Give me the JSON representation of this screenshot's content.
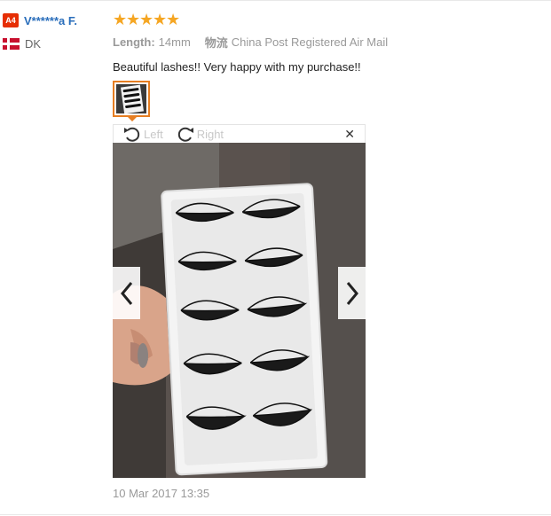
{
  "buyer": {
    "level_badge": "A4",
    "name": "V******a F.",
    "country": "DK"
  },
  "review": {
    "rating": 5,
    "attributes": {
      "length_label": "Length:",
      "length_value": "14mm",
      "shipping_label": "物流",
      "shipping_value": "China Post Registered Air Mail"
    },
    "text": "Beautiful lashes!! Very happy with my purchase!!",
    "date": "10 Mar 2017 13:35"
  },
  "viewer": {
    "rotate_left_label": "Left",
    "rotate_right_label": "Right",
    "close_glyph": "✕"
  },
  "icons": {
    "star": "star-icon",
    "rotate_left": "rotate-left-icon",
    "rotate_right": "rotate-right-icon",
    "close": "close-icon",
    "prev": "chevron-left-icon",
    "next": "chevron-right-icon"
  },
  "colors": {
    "star": "#f5a623",
    "username": "#2a6ebb",
    "badge": "#e62e04",
    "thumb_border": "#e67e22"
  }
}
